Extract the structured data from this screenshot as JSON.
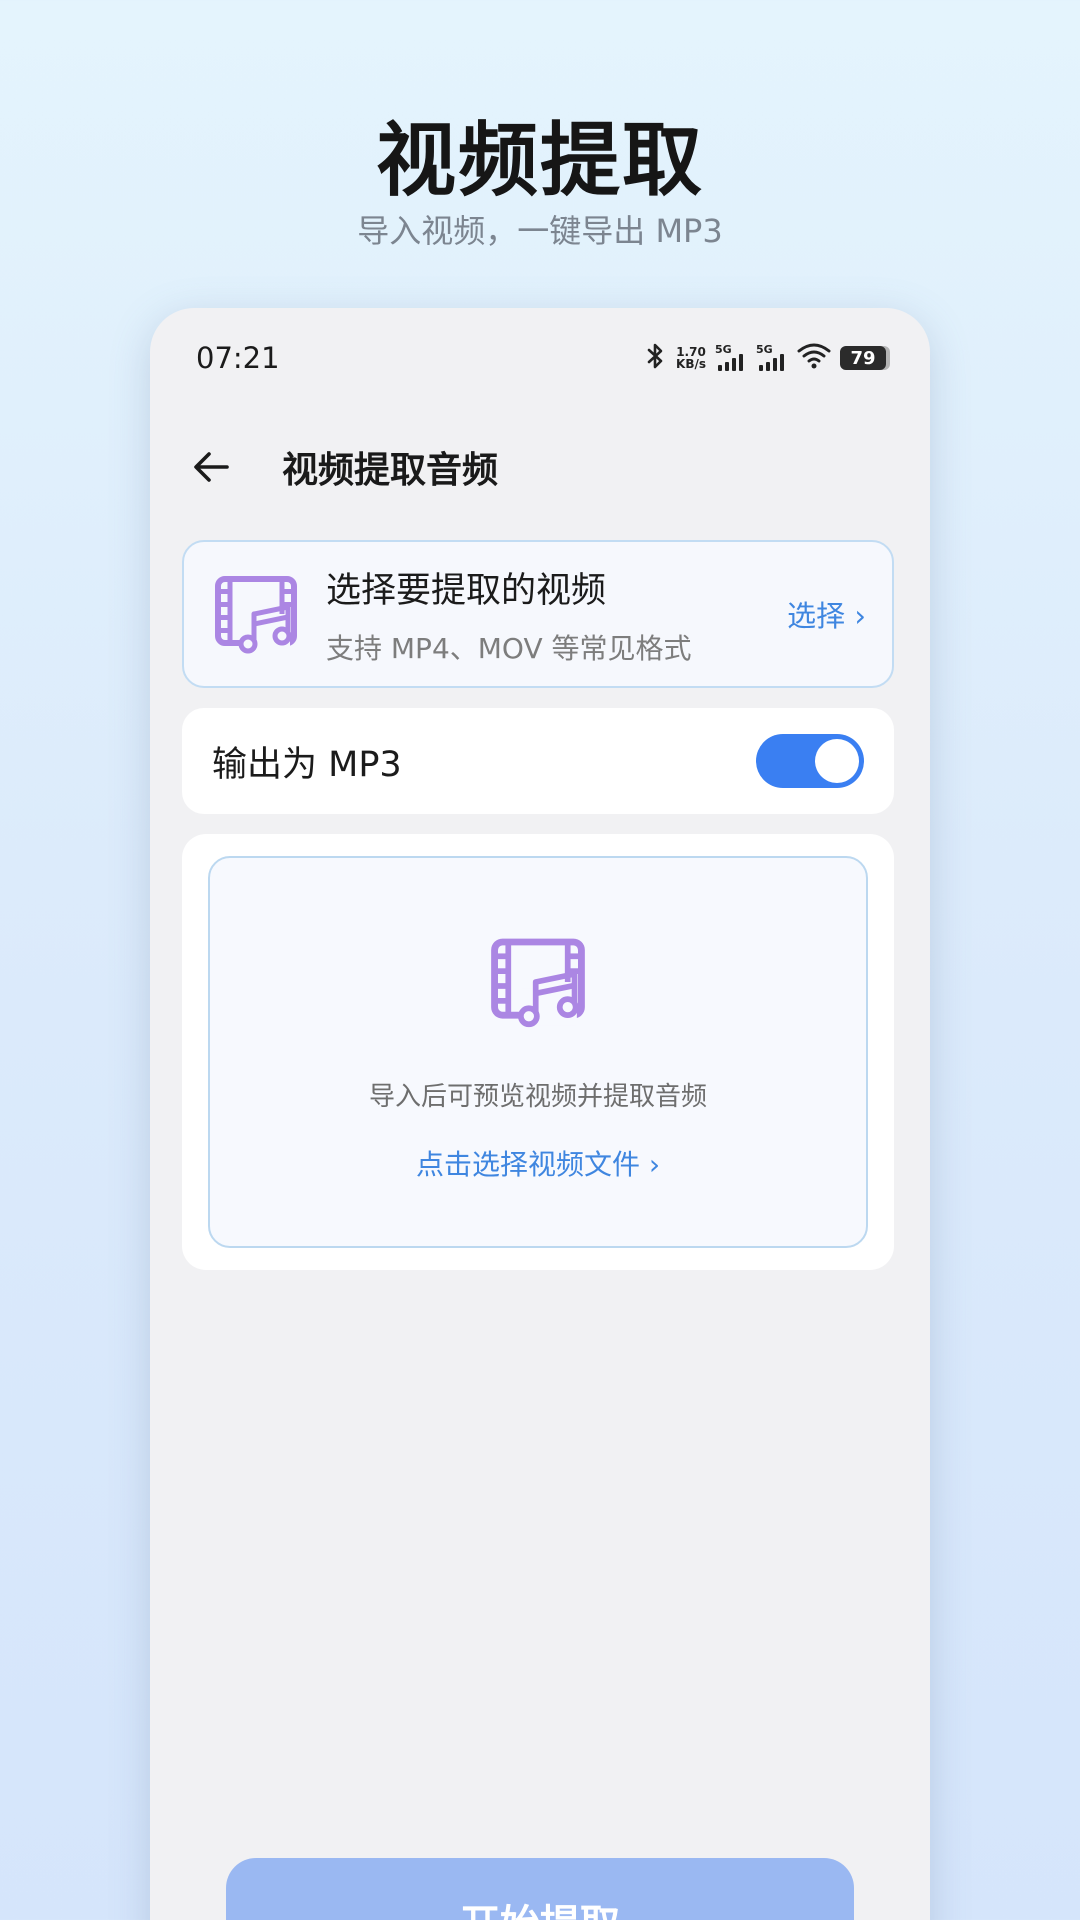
{
  "hero": {
    "title": "视频提取",
    "subtitle": "导入视频，一键导出 MP3"
  },
  "status_bar": {
    "time": "07:21",
    "net_speed_value": "1.70",
    "net_speed_unit": "KB/s",
    "signal_1": "5G",
    "signal_2": "5G",
    "battery": "79",
    "icons": [
      "bluetooth-icon",
      "signal-icon",
      "signal-icon",
      "wifi-icon",
      "battery-icon"
    ]
  },
  "header": {
    "back_icon": "arrow-left-icon",
    "title": "视频提取音频"
  },
  "select_card": {
    "icon": "video-music-icon",
    "title": "选择要提取的视频",
    "subtitle": "支持 MP4、MOV 等常见格式",
    "action": "选择 ›"
  },
  "output": {
    "label": "输出为 MP3",
    "enabled": true
  },
  "preview": {
    "icon": "video-music-icon",
    "hint": "导入后可预览视频并提取音频",
    "link": "点击选择视频文件 ›"
  },
  "start_button": {
    "label": "开始提取"
  },
  "colors": {
    "accent": "#3a7ff2",
    "link": "#3f86e0",
    "icon_purple": "#ab86e3",
    "button_disabled": "#9ab8f2"
  }
}
